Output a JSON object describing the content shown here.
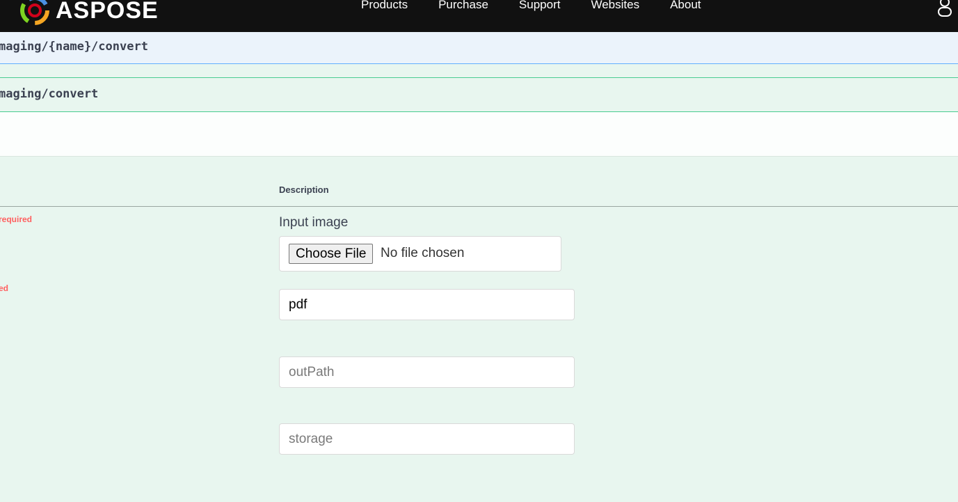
{
  "header": {
    "brand_name": "ASPOSE",
    "nav": [
      "Products",
      "Purchase",
      "Support",
      "Websites",
      "About"
    ]
  },
  "endpoints": {
    "get_path": "maging/{name}/convert",
    "post_path": "maging/convert"
  },
  "parameters": {
    "description_header": "Description",
    "rows": [
      {
        "required_flag": "required",
        "description": "Input image"
      },
      {
        "required_flag": "ed"
      }
    ],
    "file_input": {
      "button_label": "Choose File",
      "status": "No file chosen"
    },
    "format_input": {
      "value": "pdf"
    },
    "outpath_input": {
      "placeholder": "outPath"
    },
    "storage_input": {
      "placeholder": "storage"
    }
  },
  "colors": {
    "nav_background": "#111111",
    "get_accent": "#61affe",
    "post_accent": "#49cc90",
    "required_red": "#ff6060"
  }
}
